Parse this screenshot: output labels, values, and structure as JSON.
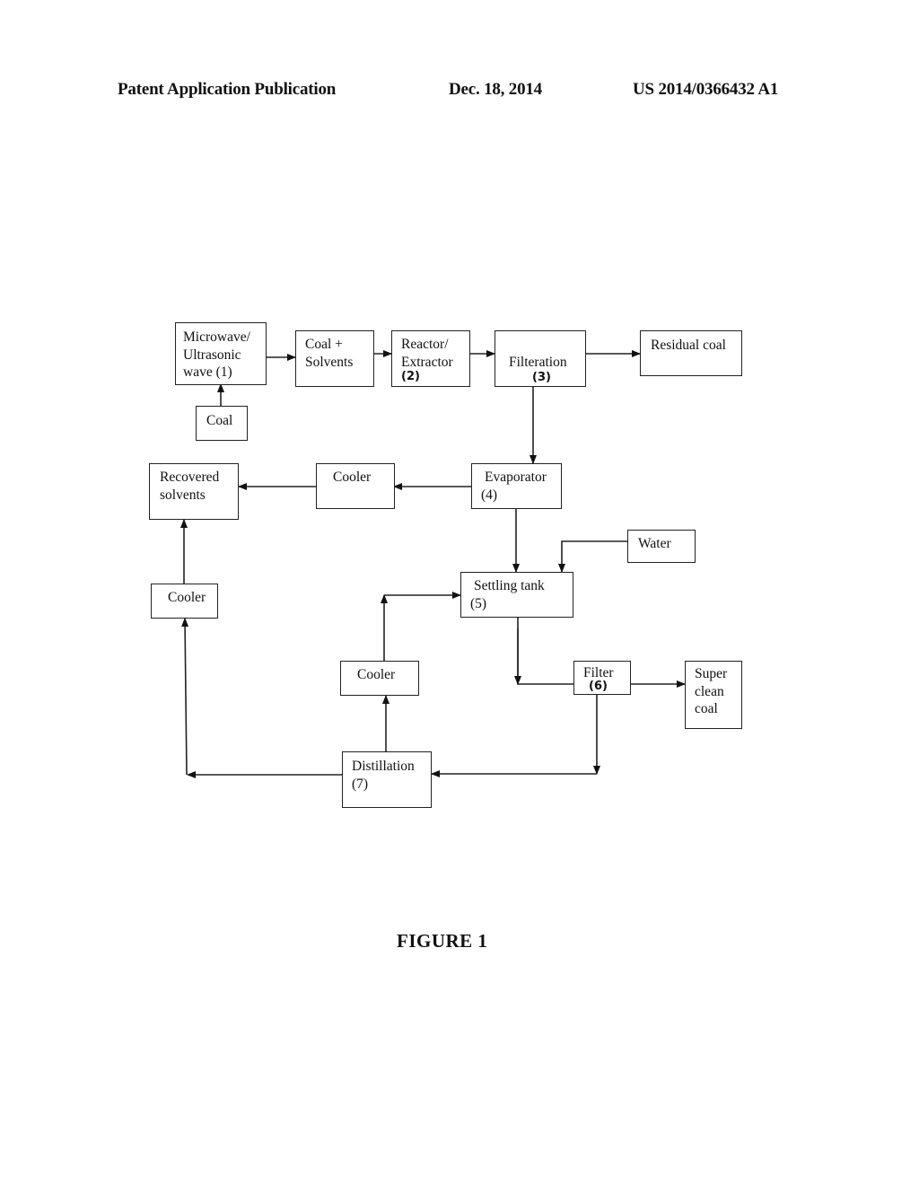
{
  "header": {
    "publication_type": "Patent Application Publication",
    "date": "Dec. 18, 2014",
    "publication_number": "US 2014/0366432 A1"
  },
  "diagram": {
    "nodes": {
      "microwave": {
        "lines": [
          "Microwave/",
          "Ultrasonic",
          "wave (1)"
        ]
      },
      "coal": {
        "lines": [
          "Coal"
        ]
      },
      "coal_solvents": {
        "lines": [
          "Coal +",
          "Solvents"
        ]
      },
      "reactor": {
        "lines": [
          "Reactor/",
          "Extractor"
        ],
        "number": "(2)"
      },
      "filteration": {
        "lines": [
          "Filteration"
        ],
        "number": "(3)"
      },
      "residual_coal": {
        "lines": [
          "Residual coal"
        ]
      },
      "evaporator": {
        "lines": [
          "Evaporator",
          "(4)"
        ]
      },
      "cooler_top": {
        "lines": [
          "Cooler"
        ]
      },
      "recovered_solvents": {
        "lines": [
          "Recovered",
          "solvents"
        ]
      },
      "water": {
        "lines": [
          "Water"
        ]
      },
      "settling_tank": {
        "lines": [
          "Settling tank",
          "(5)"
        ]
      },
      "cooler_left": {
        "lines": [
          "Cooler"
        ]
      },
      "cooler_mid": {
        "lines": [
          "Cooler"
        ]
      },
      "filter": {
        "lines": [
          "Filter"
        ],
        "number": "(6)"
      },
      "super_clean_coal": {
        "lines": [
          "Super",
          "clean",
          "coal"
        ]
      },
      "distillation": {
        "lines": [
          "Distillation",
          "(7)"
        ]
      }
    },
    "edges": [
      {
        "from": "coal",
        "to": "microwave"
      },
      {
        "from": "microwave",
        "to": "coal_solvents"
      },
      {
        "from": "coal_solvents",
        "to": "reactor"
      },
      {
        "from": "reactor",
        "to": "filteration"
      },
      {
        "from": "filteration",
        "to": "residual_coal"
      },
      {
        "from": "filteration",
        "to": "evaporator"
      },
      {
        "from": "evaporator",
        "to": "cooler_top"
      },
      {
        "from": "cooler_top",
        "to": "recovered_solvents"
      },
      {
        "from": "evaporator",
        "to": "settling_tank"
      },
      {
        "from": "water",
        "to": "settling_tank"
      },
      {
        "from": "settling_tank",
        "to": "filter"
      },
      {
        "from": "filter",
        "to": "super_clean_coal"
      },
      {
        "from": "filter",
        "to": "distillation"
      },
      {
        "from": "distillation",
        "to": "cooler_mid"
      },
      {
        "from": "cooler_mid",
        "to": "settling_tank"
      },
      {
        "from": "distillation",
        "to": "cooler_left"
      },
      {
        "from": "cooler_left",
        "to": "recovered_solvents"
      }
    ]
  },
  "caption": "FIGURE 1"
}
